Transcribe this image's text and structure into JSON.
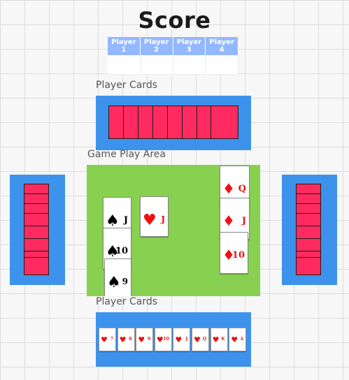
{
  "title": "Score",
  "score": {
    "headers": [
      "Player 1",
      "Player 2",
      "Player 3",
      "Player 4"
    ]
  },
  "labels": {
    "top_player": "Player Cards",
    "play_area": "Game Play Area",
    "bottom_player": "Player Cards"
  },
  "colors": {
    "panel": "#3d93eb",
    "card_back": "#ff2a5f",
    "table": "#88d150",
    "header": "#94b8ff"
  },
  "top_hand": {
    "count": 8
  },
  "left_hand": {
    "count": 8
  },
  "right_hand": {
    "count": 8
  },
  "play_area": {
    "left_column": [
      {
        "rank": "J",
        "suit": "♠",
        "color": "black"
      },
      {
        "rank": "10",
        "suit": "♠",
        "color": "black"
      },
      {
        "rank": "9",
        "suit": "♠",
        "color": "black"
      }
    ],
    "center": [
      {
        "rank": "J",
        "suit": "♥",
        "color": "red"
      }
    ],
    "right_column": [
      {
        "rank": "Q",
        "suit": "♦",
        "color": "red"
      },
      {
        "rank": "J",
        "suit": "♦",
        "color": "red"
      },
      {
        "rank": "10",
        "suit": "♦",
        "color": "red"
      }
    ]
  },
  "bottom_hand": [
    {
      "rank": "7",
      "suit": "♥"
    },
    {
      "rank": "8",
      "suit": "♥"
    },
    {
      "rank": "9",
      "suit": "♥"
    },
    {
      "rank": "10",
      "suit": "♥"
    },
    {
      "rank": "J",
      "suit": "♥"
    },
    {
      "rank": "Q",
      "suit": "♥"
    },
    {
      "rank": "K",
      "suit": "♥"
    },
    {
      "rank": "A",
      "suit": "♥"
    }
  ]
}
